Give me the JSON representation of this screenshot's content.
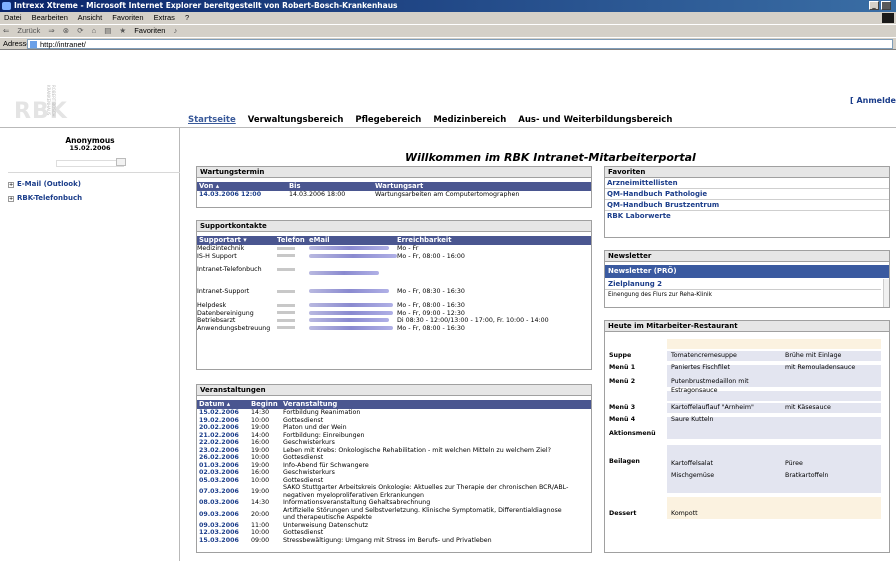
{
  "browser": {
    "title": "Intrexx Xtreme - Microsoft Internet Explorer bereitgestellt von Robert-Bosch-Krankenhaus",
    "menu": [
      "Datei",
      "Bearbeiten",
      "Ansicht",
      "Favoriten",
      "Extras",
      "?"
    ],
    "toolbar": {
      "back": "Zurück",
      "favorites": "Favoriten"
    },
    "address_label": "Adresse",
    "address": "http://intranet/"
  },
  "header": {
    "logo": "RBK",
    "logo_sub": "ROBERT BOSCH KRANKENHAUS",
    "login": "[ Anmelden",
    "nav": [
      "Startseite",
      "Verwaltungsbereich",
      "Pflegebereich",
      "Medizinbereich",
      "Aus- und Weiterbildungsbereich"
    ]
  },
  "user": {
    "name": "Anonymous",
    "date": "15.02.2006"
  },
  "left_items": [
    "E-Mail (Outlook)",
    "RBK-Telefonbuch"
  ],
  "welcome": "Willkommen im RBK Intranet-Mitarbeiterportal",
  "wartung": {
    "title": "Wartungstermin",
    "headers": [
      "Von",
      "Bis",
      "Wartungsart"
    ],
    "rows": [
      [
        "14.03.2006 12:00",
        "14.03.2006 18:00",
        "Wartungsarbeiten am Computertomographen"
      ]
    ]
  },
  "support": {
    "title": "Supportkontakte",
    "headers": [
      "Supportart",
      "Telefon",
      "eMail",
      "Erreichbarkeit"
    ],
    "rows": [
      [
        "Medizintechnik",
        "Mo - Fr"
      ],
      [
        "IS-H Support",
        "Mo - Fr, 08:00 - 16:00"
      ],
      [
        "Intranet-Telefonbuch",
        ""
      ],
      [
        "Intranet-Support",
        "Mo - Fr, 08:30 - 16:30"
      ],
      [
        "Helpdesk",
        "Mo - Fr, 08:00 - 16:30"
      ],
      [
        "Datenbereinigung",
        "Mo - Fr, 09:00 - 12:30"
      ],
      [
        "Betriebsarzt",
        "Di 08:30 - 12:00/13:00 - 17:00, Fr. 10:00 - 14:00"
      ],
      [
        "Anwendungsbetreuung",
        "Mo - Fr, 08:00 - 16:30"
      ]
    ]
  },
  "events": {
    "title": "Veranstaltungen",
    "headers": [
      "Datum",
      "Beginn",
      "Veranstaltung"
    ],
    "rows": [
      [
        "15.02.2006",
        "14:30",
        "Fortbildung Reanimation"
      ],
      [
        "19.02.2006",
        "10:00",
        "Gottesdienst"
      ],
      [
        "20.02.2006",
        "19:00",
        "Platon und der Wein"
      ],
      [
        "21.02.2006",
        "14:00",
        "Fortbildung: Einreibungen"
      ],
      [
        "22.02.2006",
        "16:00",
        "Geschwisterkurs"
      ],
      [
        "23.02.2006",
        "19:00",
        "Leben mit Krebs: Onkologische Rehabilitation - mit welchen Mitteln zu welchem Ziel?"
      ],
      [
        "26.02.2006",
        "10:00",
        "Gottesdienst"
      ],
      [
        "01.03.2006",
        "19:00",
        "Info-Abend für Schwangere"
      ],
      [
        "02.03.2006",
        "16:00",
        "Geschwisterkurs"
      ],
      [
        "05.03.2006",
        "10:00",
        "Gottesdienst"
      ],
      [
        "07.03.2006",
        "19:00",
        "SAKO Stuttgarter Arbeitskreis Onkologie: Aktuelles zur Therapie der chronischen BCR/ABL-",
        "negativen myeloproliferativen Erkrankungen"
      ],
      [
        "08.03.2006",
        "14:30",
        "Informationsveranstaltung Gehaltsabrechnung"
      ],
      [
        "09.03.2006",
        "20:00",
        "Artifizielle Störungen und Selbstverletzung. Klinische Symptomatik, Differentialdiagnose",
        "und therapeutische Aspekte"
      ],
      [
        "09.03.2006",
        "11:00",
        "Unterweisung Datenschutz"
      ],
      [
        "12.03.2006",
        "10:00",
        "Gottesdienst"
      ],
      [
        "15.03.2006",
        "09:00",
        "Stressbewältigung: Umgang mit Stress im Berufs- und Privatleben"
      ]
    ]
  },
  "favoriten": {
    "title": "Favoriten",
    "items": [
      "Arzneimittellisten",
      "QM-Handbuch Pathologie",
      "QM-Handbuch Brustzentrum",
      "RBK Laborwerte"
    ]
  },
  "newsletter": {
    "title": "Newsletter",
    "selected": "Newsletter (PRÖ)",
    "items": [
      "Zielplanung 2",
      "Einengung des Flurs zur Reha-Klinik"
    ]
  },
  "restaurant": {
    "title": "Heute im Mitarbeiter-Restaurant",
    "rows": [
      {
        "label": "Suppe",
        "a": "Tomatencremesuppe",
        "b": "Brühe mit Einlage"
      },
      {
        "label": "Menü 1",
        "a": "Paniertes Fischfilet",
        "b": "mit Remouladensauce"
      },
      {
        "label": "Menü 2",
        "a": "Putenbrustmedaillon mit",
        "a2": "Estragonsauce",
        "b": ""
      },
      {
        "label": "Menü 3",
        "a": "Kartoffelauflauf \"Arnheim\"",
        "b": "mit Käsesauce"
      },
      {
        "label": "Menü 4",
        "a": "Saure Kutteln",
        "b": ""
      },
      {
        "label": "Aktionsmenü",
        "a": "",
        "b": ""
      },
      {
        "label": "Beilagen",
        "a": "Kartoffelsalat",
        "b": "Püree",
        "a2": "Mischgemüse",
        "b2": "Bratkartoffeln"
      },
      {
        "label": "Dessert",
        "a": "Kompott",
        "b": ""
      }
    ]
  }
}
